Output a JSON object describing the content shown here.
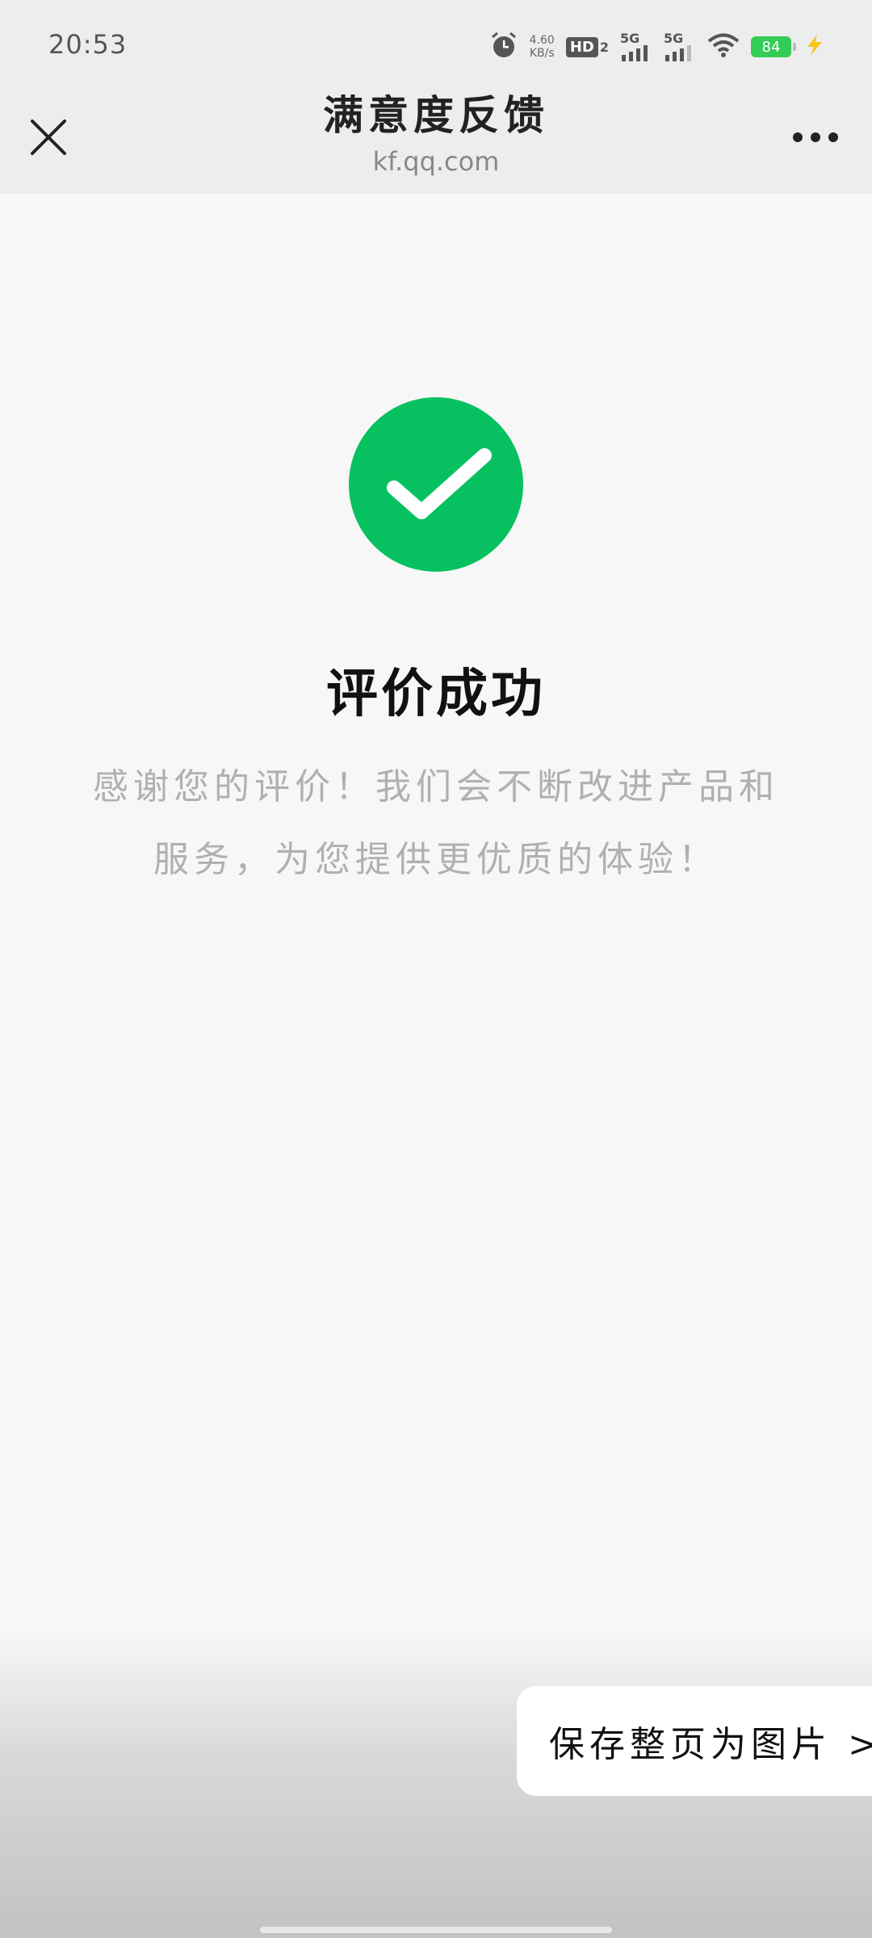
{
  "status_bar": {
    "time": "20:53",
    "net_speed_value": "4.60",
    "net_speed_unit": "KB/s",
    "hd_label": "HD",
    "hd_sub": "2",
    "signal1_label": "5G",
    "signal2_label": "5G",
    "battery_level": "84",
    "colors": {
      "battery": "#33cc55",
      "charging": "#f5c518"
    }
  },
  "header": {
    "title": "满意度反馈",
    "url": "kf.qq.com"
  },
  "result": {
    "title": "评价成功",
    "message": "感谢您的评价！我们会不断改进产品和服务，为您提供更优质的体验！",
    "accent_color": "#07c160"
  },
  "bottom_action": {
    "save_label": "保存整页为图片 >"
  }
}
